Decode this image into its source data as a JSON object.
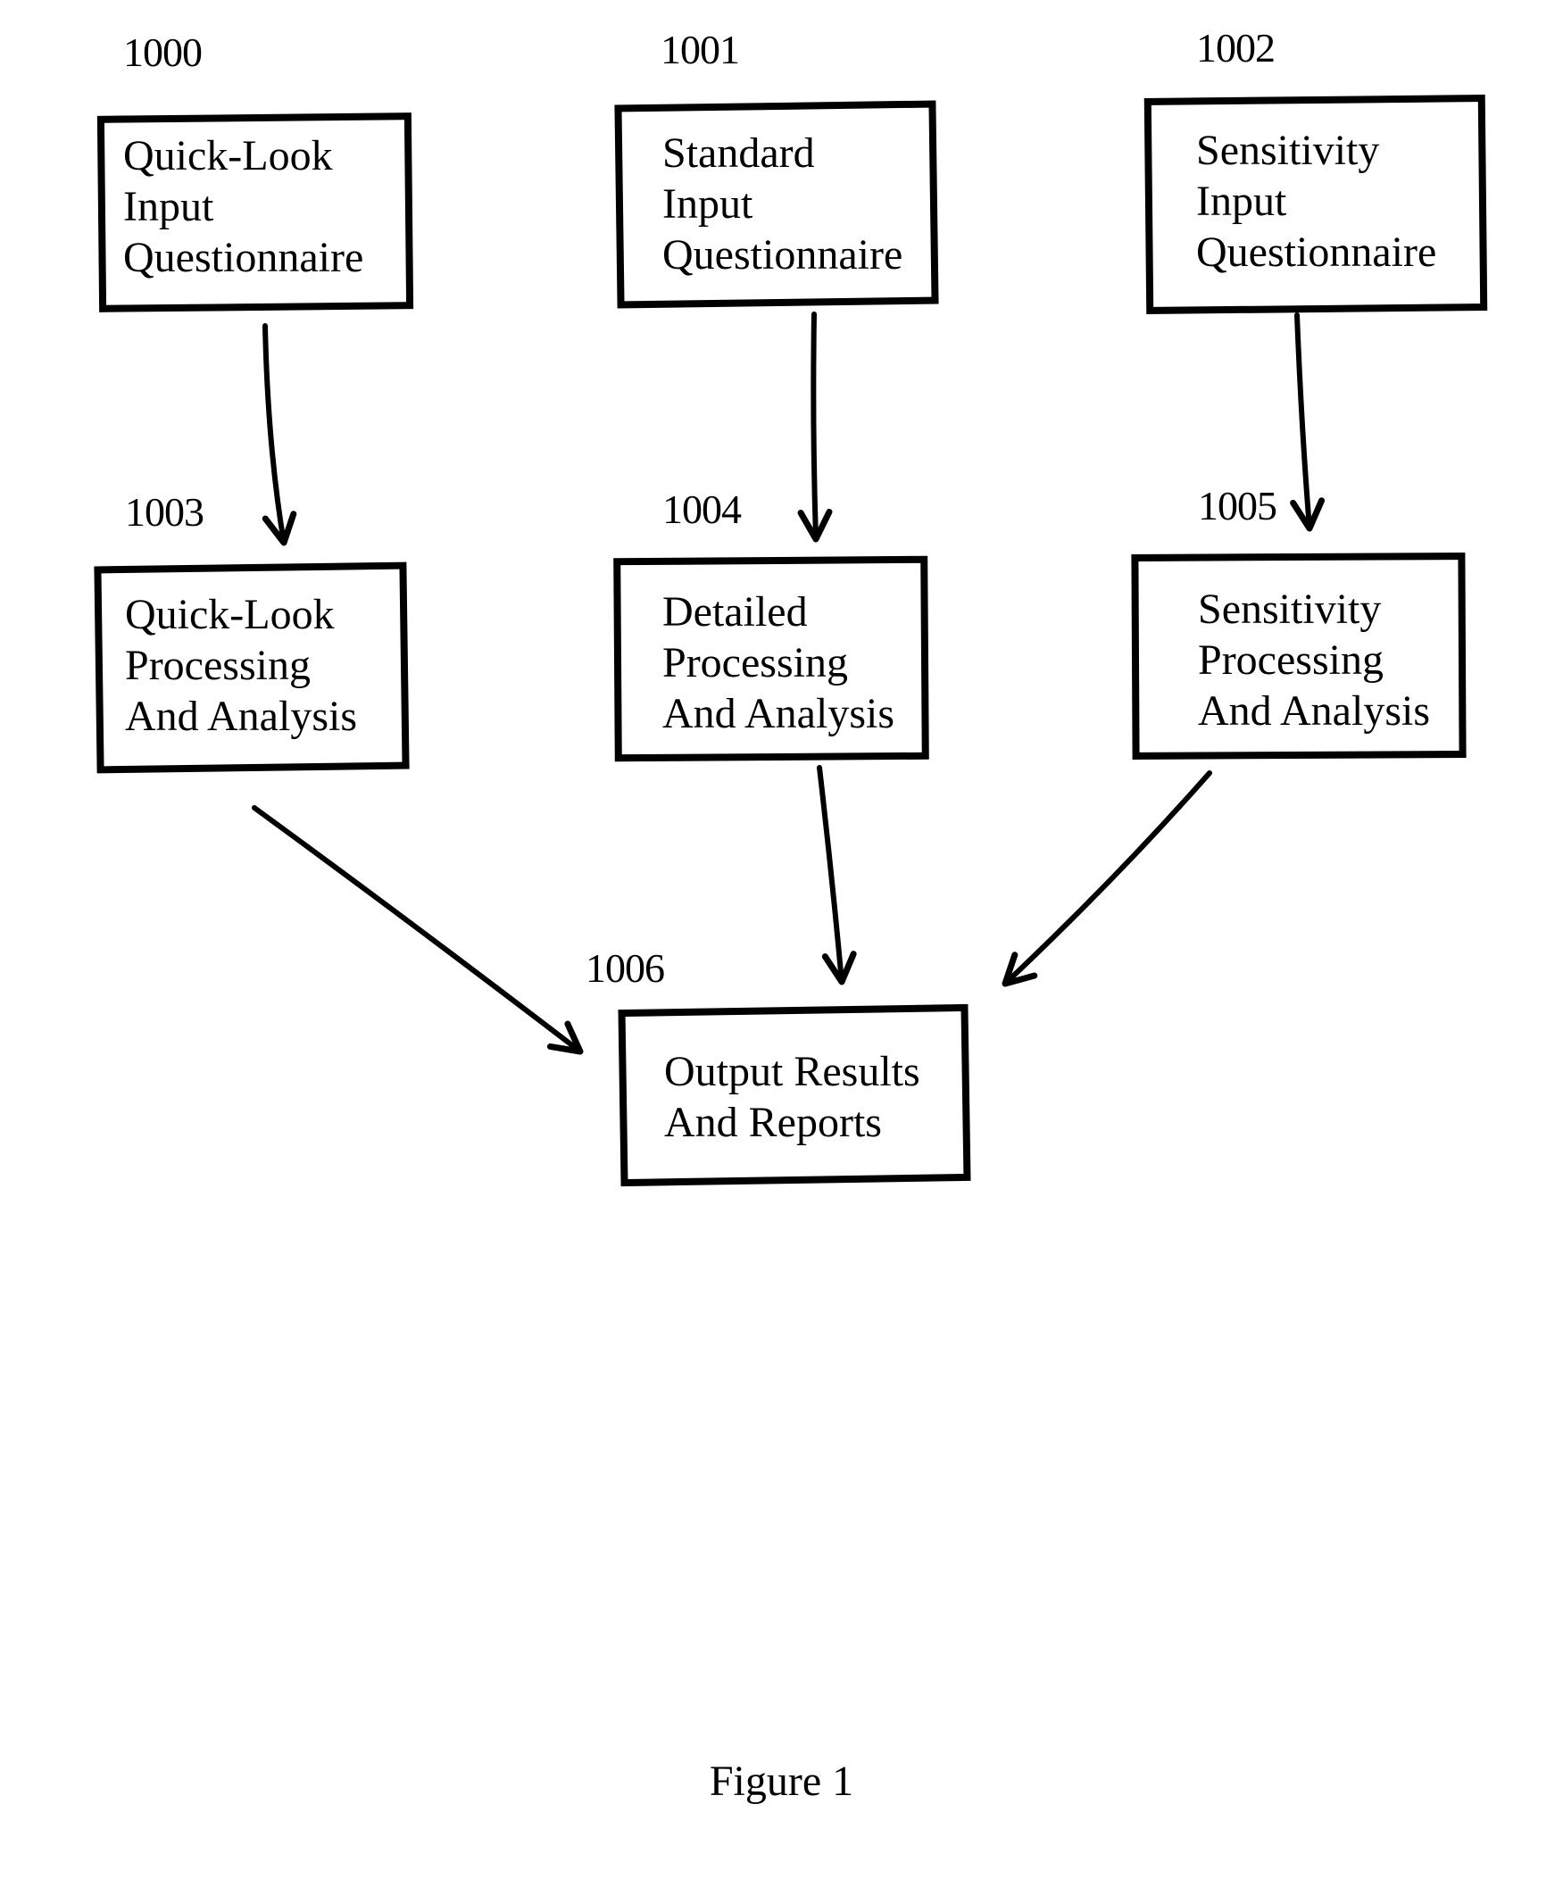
{
  "diagram": {
    "nodes": [
      {
        "id": "1000",
        "ref": "1000",
        "lines": [
          "Quick-Look",
          "Input",
          "Questionnaire"
        ]
      },
      {
        "id": "1001",
        "ref": "1001",
        "lines": [
          "Standard",
          "Input",
          "Questionnaire"
        ]
      },
      {
        "id": "1002",
        "ref": "1002",
        "lines": [
          "Sensitivity",
          "Input",
          "Questionnaire"
        ]
      },
      {
        "id": "1003",
        "ref": "1003",
        "lines": [
          "Quick-Look",
          "Processing",
          "And Analysis"
        ]
      },
      {
        "id": "1004",
        "ref": "1004",
        "lines": [
          "Detailed",
          "Processing",
          "And Analysis"
        ]
      },
      {
        "id": "1005",
        "ref": "1005",
        "lines": [
          "Sensitivity",
          "Processing",
          "And Analysis"
        ]
      },
      {
        "id": "1006",
        "ref": "1006",
        "lines": [
          "Output Results",
          "And Reports"
        ]
      }
    ],
    "edges": [
      {
        "from": "1000",
        "to": "1003"
      },
      {
        "from": "1001",
        "to": "1004"
      },
      {
        "from": "1002",
        "to": "1005"
      },
      {
        "from": "1003",
        "to": "1006"
      },
      {
        "from": "1004",
        "to": "1006"
      },
      {
        "from": "1005",
        "to": "1006"
      }
    ],
    "caption": "Figure 1",
    "line_color": "#000000",
    "background": "#ffffff"
  }
}
